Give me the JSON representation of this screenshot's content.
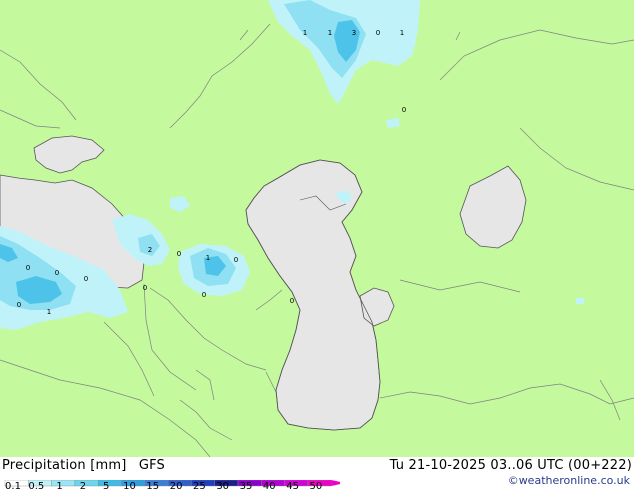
{
  "map": {
    "labels": [
      "1",
      "1",
      "3",
      "0",
      "1",
      "0",
      "2",
      "0",
      "1",
      "0",
      "0",
      "0",
      "0",
      "0",
      "0",
      "0",
      "1",
      "0"
    ]
  },
  "footer": {
    "title": "Precipitation [mm]",
    "model": "GFS",
    "datetime": "Tu 21-10-2025 03..06 UTC (00+222)",
    "credit": "©weatheronline.co.uk"
  },
  "legend": {
    "ticks": [
      "0.1",
      "0.5",
      "1",
      "2",
      "5",
      "10",
      "15",
      "20",
      "25",
      "30",
      "35",
      "40",
      "45",
      "50"
    ],
    "colors": [
      "#ffffff",
      "#bff3f9",
      "#99e6f4",
      "#6ed6ec",
      "#3fbce6",
      "#2e9fe0",
      "#3a7fd8",
      "#2f5fce",
      "#1e3fbe",
      "#1a1f8e",
      "#8d00cf",
      "#b300d6",
      "#d400db",
      "#ee00c8"
    ]
  },
  "colors": {
    "land": "#c4f99d",
    "water": "#e6e6e6",
    "border": "#808080",
    "coast": "#555555",
    "precip_light": "#bff3f9",
    "precip_mid": "#8fe0f2",
    "precip_dark": "#4ec3ea"
  }
}
